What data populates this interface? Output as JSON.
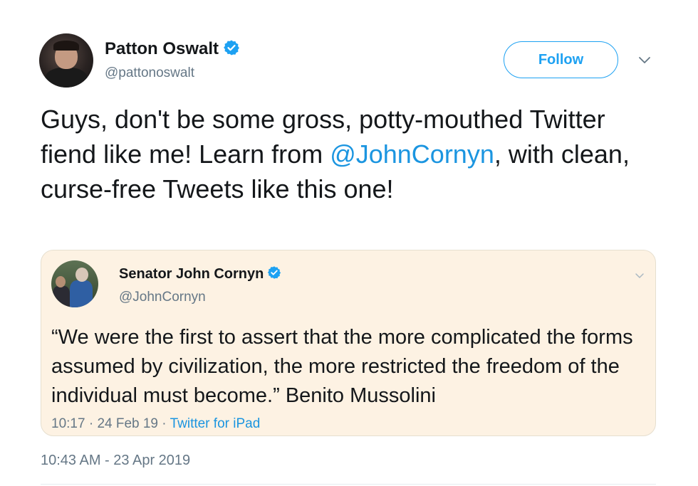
{
  "author": {
    "name": "Patton Oswalt",
    "handle": "@pattonoswalt",
    "verified": true,
    "avatar_icon": "avatar-photo"
  },
  "follow_button": {
    "label": "Follow"
  },
  "menu_icon": "chevron-down-icon",
  "tweet": {
    "text_before": "Guys, don't be some gross, potty-mouthed Twitter fiend like me! Learn from ",
    "mention": "@JohnCornyn",
    "text_after": ", with clean, curse-free Tweets like this one!"
  },
  "quoted_tweet": {
    "name": "Senator John Cornyn",
    "handle": "@JohnCornyn",
    "verified": true,
    "text": "“We were the first to assert that the more complicated the forms assumed by civilization, the more restricted the freedom of the individual must become.” Benito Mussolini",
    "time": "10:17",
    "date": "24 Feb 19",
    "separator": " · ",
    "source": "Twitter for iPad"
  },
  "timestamp": "10:43 AM - 23 Apr 2019",
  "colors": {
    "accent": "#1da1f2",
    "link": "#1b95e0",
    "muted": "#657786",
    "quote_background": "#fdf2e3"
  }
}
